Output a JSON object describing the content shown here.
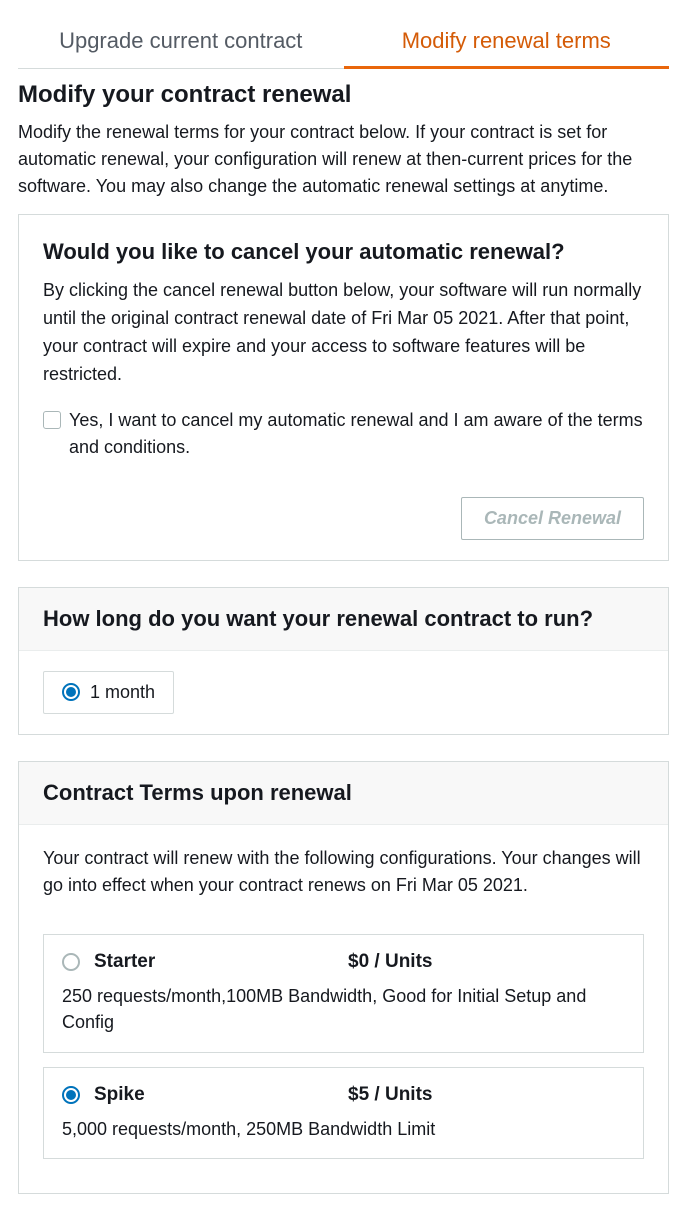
{
  "tabs": [
    {
      "label": "Upgrade current contract",
      "active": false
    },
    {
      "label": "Modify renewal terms",
      "active": true
    }
  ],
  "page": {
    "title": "Modify your contract renewal",
    "description": "Modify the renewal terms for your contract below. If your contract is set for automatic renewal, your configuration will renew at then-current prices for the software. You may also change the automatic renewal settings at anytime."
  },
  "cancel_section": {
    "heading": "Would you like to cancel your automatic renewal?",
    "text": "By clicking the cancel renewal button below, your software will run normally until the original contract renewal date of Fri Mar 05 2021. After that point, your contract will expire and your access to software features will be restricted.",
    "checkbox_label": "Yes, I want to cancel my automatic renewal and I am aware of the terms and conditions.",
    "button_label": "Cancel Renewal"
  },
  "duration_section": {
    "heading": "How long do you want your renewal contract to run?",
    "options": [
      {
        "label": "1 month",
        "selected": true
      }
    ]
  },
  "terms_section": {
    "heading": "Contract Terms upon renewal",
    "intro": "Your contract will renew with the following configurations. Your changes will go into effect when your contract renews on Fri Mar 05 2021.",
    "plans": [
      {
        "name": "Starter",
        "price": "$0 / Units",
        "desc": "250 requests/month,100MB Bandwidth, Good for Initial Setup and Config",
        "selected": false
      },
      {
        "name": "Spike",
        "price": "$5 / Units",
        "desc": "5,000 requests/month, 250MB Bandwidth Limit",
        "selected": true
      }
    ]
  }
}
